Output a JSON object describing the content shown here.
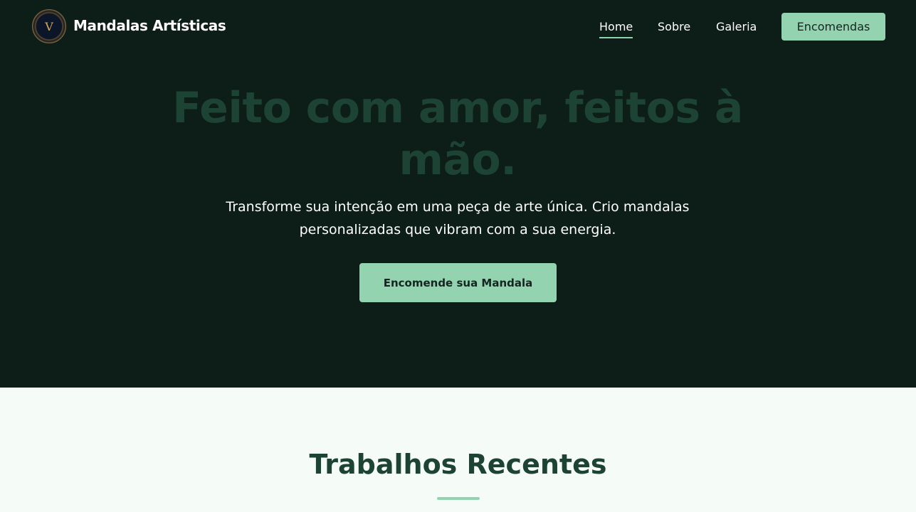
{
  "brand": {
    "logo_letter": "V",
    "name": "Mandalas Artísticas"
  },
  "nav": {
    "links": [
      {
        "label": "Home"
      },
      {
        "label": "Sobre"
      },
      {
        "label": "Galeria"
      }
    ],
    "cta": "Encomendas"
  },
  "hero": {
    "title": "Feito com amor, feitos à mão.",
    "subtitle": "Transforme sua intenção em uma peça de arte única. Crio mandalas personalizadas que vibram com a sua energia.",
    "cta": "Encomende sua Mandala"
  },
  "recent": {
    "title": "Trabalhos Recentes"
  },
  "colors": {
    "hero_bg": "#0d1d18",
    "accent": "#93d3b0",
    "title_green": "#1c4333",
    "section_bg": "#f5fbf6"
  }
}
